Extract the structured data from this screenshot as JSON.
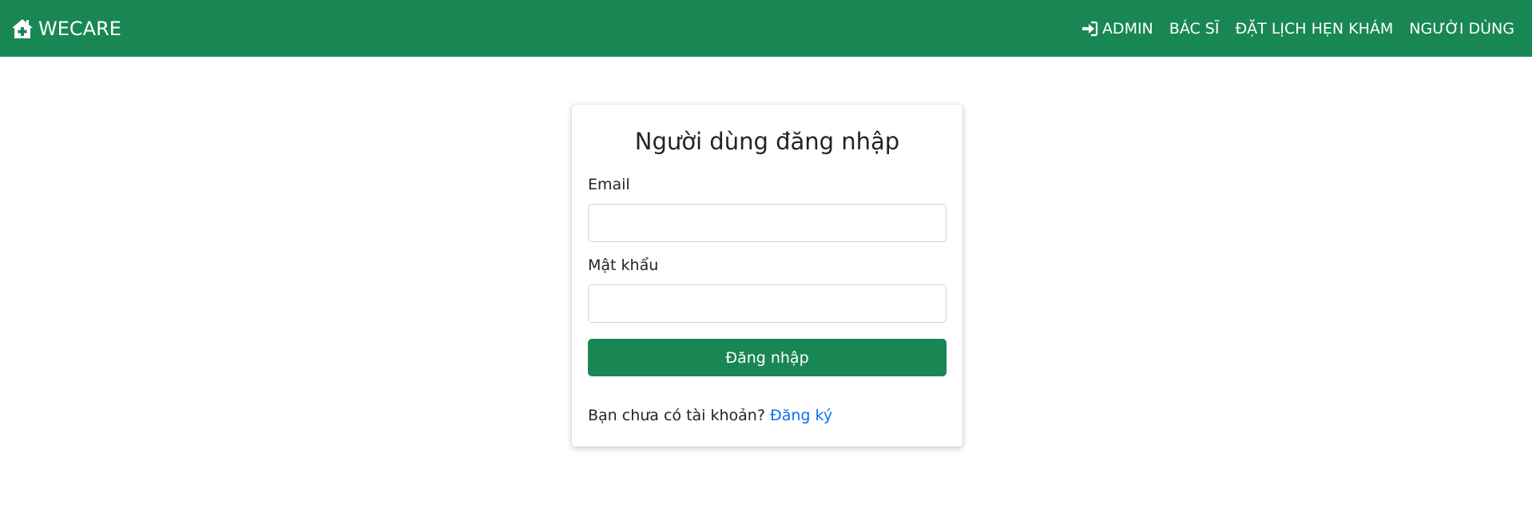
{
  "navbar": {
    "brand": {
      "icon": "house-medical-icon",
      "label": "WECARE"
    },
    "links": [
      {
        "icon": "sign-in-icon",
        "label": "ADMIN"
      },
      {
        "label": "BÁC SĨ"
      },
      {
        "label": "ĐẶT LỊCH HẸN KHÁM"
      },
      {
        "label": "NGƯỜI DÙNG"
      }
    ],
    "color": "#198754"
  },
  "login": {
    "title": "Người dùng đăng nhập",
    "email_label": "Email",
    "email_value": "",
    "password_label": "Mật khẩu",
    "password_value": "",
    "submit_label": "Đăng nhập",
    "register_prompt": "Bạn chưa có tài khoản?",
    "register_link": "Đăng ký",
    "link_color": "#0d6efd"
  }
}
